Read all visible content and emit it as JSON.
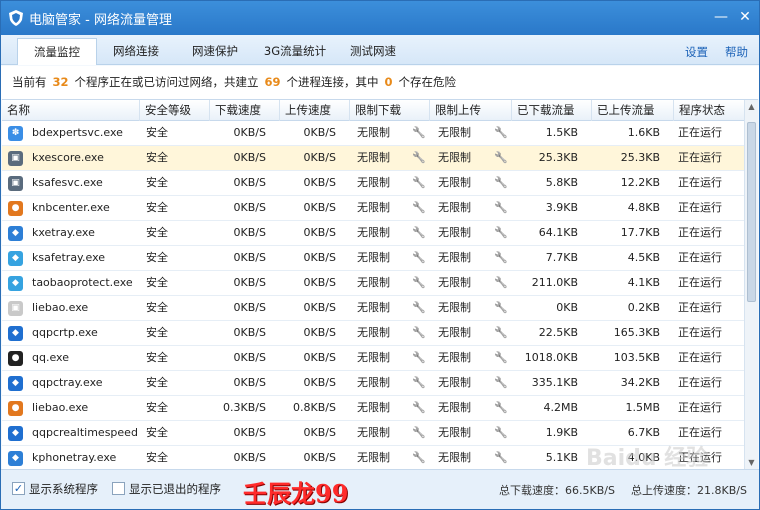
{
  "window": {
    "title": "电脑管家 - 网络流量管理",
    "min": "—",
    "close": "✕"
  },
  "tabs": [
    "流量监控",
    "网络连接",
    "网速保护",
    "3G流量统计",
    "测试网速"
  ],
  "toplinks": {
    "settings": "设置",
    "help": "帮助"
  },
  "summary": {
    "p1": "当前有",
    "programs": "32",
    "p2": "个程序正在或已访问过网络，共建立",
    "connections": "69",
    "p3": "个进程连接，其中",
    "danger": "0",
    "p4": "个存在危险"
  },
  "columns": [
    "名称",
    "安全等级",
    "下载速度",
    "上传速度",
    "限制下载",
    "限制上传",
    "已下载流量",
    "已上传流量",
    "程序状态"
  ],
  "rows": [
    {
      "name": "bdexpertsvc.exe",
      "icon": "baidu-icon",
      "color": "#3a8ee6",
      "safety": "安全",
      "down": "0KB/S",
      "up": "0KB/S",
      "limdown": "无限制",
      "limup": "无限制",
      "downed": "1.5KB",
      "uped": "1.6KB",
      "status": "正在运行"
    },
    {
      "name": "kxescore.exe",
      "icon": "app-window-icon",
      "color": "#5a6b7d",
      "safety": "安全",
      "down": "0KB/S",
      "up": "0KB/S",
      "limdown": "无限制",
      "limup": "无限制",
      "downed": "25.3KB",
      "uped": "25.3KB",
      "status": "正在运行"
    },
    {
      "name": "ksafesvc.exe",
      "icon": "app-window-icon",
      "color": "#5a6b7d",
      "safety": "安全",
      "down": "0KB/S",
      "up": "0KB/S",
      "limdown": "无限制",
      "limup": "无限制",
      "downed": "5.8KB",
      "uped": "12.2KB",
      "status": "正在运行"
    },
    {
      "name": "knbcenter.exe",
      "icon": "knb-icon",
      "color": "#e2781f",
      "safety": "安全",
      "down": "0KB/S",
      "up": "0KB/S",
      "limdown": "无限制",
      "limup": "无限制",
      "downed": "3.9KB",
      "uped": "4.8KB",
      "status": "正在运行"
    },
    {
      "name": "kxetray.exe",
      "icon": "shield-icon",
      "color": "#2d7fd6",
      "safety": "安全",
      "down": "0KB/S",
      "up": "0KB/S",
      "limdown": "无限制",
      "limup": "无限制",
      "downed": "64.1KB",
      "uped": "17.7KB",
      "status": "正在运行"
    },
    {
      "name": "ksafetray.exe",
      "icon": "shield-icon",
      "color": "#36a3e0",
      "safety": "安全",
      "down": "0KB/S",
      "up": "0KB/S",
      "limdown": "无限制",
      "limup": "无限制",
      "downed": "7.7KB",
      "uped": "4.5KB",
      "status": "正在运行"
    },
    {
      "name": "taobaoprotect.exe",
      "icon": "shield-icon",
      "color": "#36a3e0",
      "safety": "安全",
      "down": "0KB/S",
      "up": "0KB/S",
      "limdown": "无限制",
      "limup": "无限制",
      "downed": "211.0KB",
      "uped": "4.1KB",
      "status": "正在运行"
    },
    {
      "name": "liebao.exe",
      "icon": "app-window-icon",
      "color": "#c9c9c9",
      "safety": "安全",
      "down": "0KB/S",
      "up": "0KB/S",
      "limdown": "无限制",
      "limup": "无限制",
      "downed": "0KB",
      "uped": "0.2KB",
      "status": "正在运行"
    },
    {
      "name": "qqpcrtp.exe",
      "icon": "shield-icon",
      "color": "#1f6fd0",
      "safety": "安全",
      "down": "0KB/S",
      "up": "0KB/S",
      "limdown": "无限制",
      "limup": "无限制",
      "downed": "22.5KB",
      "uped": "165.3KB",
      "status": "正在运行"
    },
    {
      "name": "qq.exe",
      "icon": "penguin-icon",
      "color": "#222222",
      "safety": "安全",
      "down": "0KB/S",
      "up": "0KB/S",
      "limdown": "无限制",
      "limup": "无限制",
      "downed": "1018.0KB",
      "uped": "103.5KB",
      "status": "正在运行"
    },
    {
      "name": "qqpctray.exe",
      "icon": "shield-icon",
      "color": "#1f6fd0",
      "safety": "安全",
      "down": "0KB/S",
      "up": "0KB/S",
      "limdown": "无限制",
      "limup": "无限制",
      "downed": "335.1KB",
      "uped": "34.2KB",
      "status": "正在运行"
    },
    {
      "name": "liebao.exe",
      "icon": "liebao-icon",
      "color": "#e2781f",
      "safety": "安全",
      "down": "0.3KB/S",
      "up": "0.8KB/S",
      "limdown": "无限制",
      "limup": "无限制",
      "downed": "4.2MB",
      "uped": "1.5MB",
      "status": "正在运行"
    },
    {
      "name": "qqpcrealtimespeed...",
      "icon": "shield-icon",
      "color": "#1f6fd0",
      "safety": "安全",
      "down": "0KB/S",
      "up": "0KB/S",
      "limdown": "无限制",
      "limup": "无限制",
      "downed": "1.9KB",
      "uped": "6.7KB",
      "status": "正在运行"
    },
    {
      "name": "kphonetray.exe",
      "icon": "phone-icon",
      "color": "#2d7fd6",
      "safety": "安全",
      "down": "0KB/S",
      "up": "0KB/S",
      "limdown": "无限制",
      "limup": "无限制",
      "downed": "5.1KB",
      "uped": "4.0KB",
      "status": "正在运行"
    }
  ],
  "footer": {
    "show_system": "显示系统程序",
    "show_exited": "显示已退出的程序",
    "stamp": "壬辰龙99",
    "total_down": "总下载速度：66.5KB/S",
    "total_up": "总上传速度：21.8KB/S"
  },
  "watermark": "Baidu 经验"
}
